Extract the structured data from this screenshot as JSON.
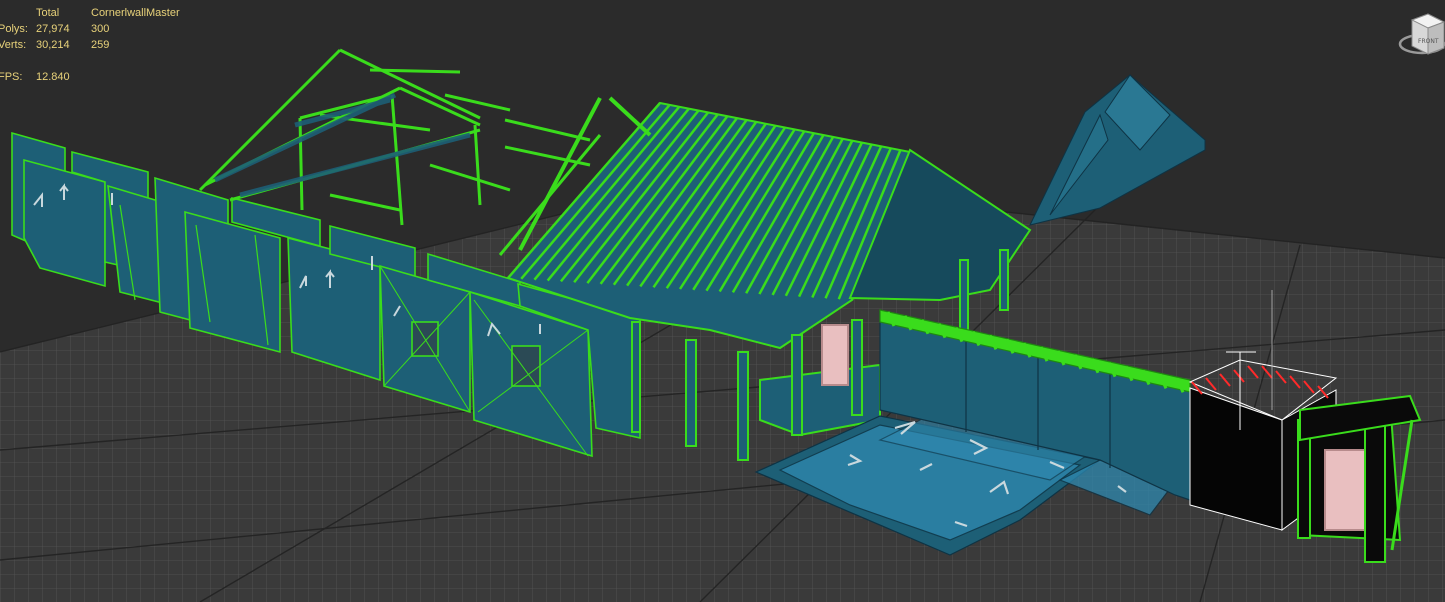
{
  "viewport": {
    "background_color": "#2b2b2b",
    "grid_color": "#4d4d4d",
    "wire_color": "#3adc1c",
    "mesh_color": "#1d5f76",
    "selection_color": "#ffffff"
  },
  "stats": {
    "header_total": "Total",
    "header_selection": "CornerlwallMaster",
    "polys_label": "Polys:",
    "polys_total": "27,974",
    "polys_selection": "300",
    "verts_label": "Verts:",
    "verts_total": "30,214",
    "verts_selection": "259",
    "fps_label": "FPS:",
    "fps_value": "12.840",
    "text_color": "#e8d27a"
  },
  "viewcube": {
    "icon": "viewcube-icon",
    "face_label": "FRONT"
  }
}
